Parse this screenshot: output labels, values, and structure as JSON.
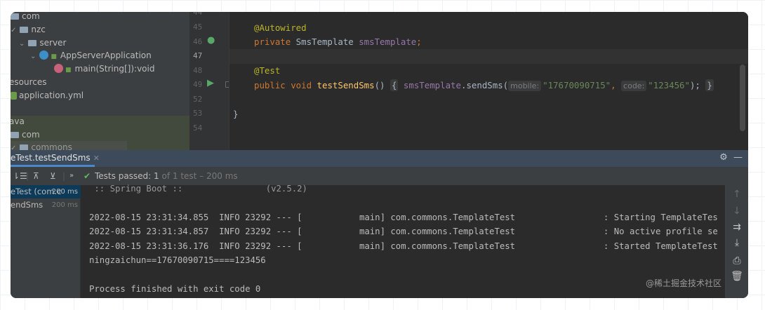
{
  "project_tree": [
    {
      "label": "com",
      "icon": "folder-icon"
    },
    {
      "label": "nzc",
      "icon": "package-icon"
    },
    {
      "label": "server",
      "icon": "package-icon"
    },
    {
      "label": "AppServerApplication",
      "icon": "spring-boot-class-icon"
    },
    {
      "label": "main(String[]):void",
      "icon": "method-icon"
    },
    {
      "label": "esources",
      "icon": ""
    },
    {
      "label": "application.yml",
      "icon": "yaml-file-icon"
    },
    {
      "label": "ava",
      "icon": ""
    },
    {
      "label": "com",
      "icon": "package-icon"
    },
    {
      "label": "commons",
      "icon": "package-icon"
    }
  ],
  "editor": {
    "line_numbers": [
      "44",
      "45",
      "46",
      "47",
      "48",
      "49",
      "52",
      "53",
      "54"
    ],
    "current_line": "47",
    "code": {
      "annotation1": "@Autowired",
      "l46_kw": "private",
      "l46_type": " SmsTemplate ",
      "l46_field": "smsTemplate",
      "l46_end": ";",
      "annotation2": "@Test",
      "l49_kw": "public void ",
      "l49_fn": "testSendSms",
      "l49_paren": "() ",
      "l49_open": "{",
      "l49_field": "smsTemplate",
      "l49_call": ".sendSms(",
      "hint_mobile": "mobile:",
      "arg_mobile": "\"17670090715\"",
      "comma": ", ",
      "hint_code": "code:",
      "arg_code": "\"123456\"",
      "l49_close": ");",
      "l49_closebrace": "}",
      "l53": "}"
    }
  },
  "run_panel": {
    "tab_label": "eTest.testSendSms",
    "status_prefix": "Tests passed: 1",
    "status_suffix": " of 1 test – 200 ms",
    "tree": [
      {
        "label": "eTest (com.c",
        "time": "200 ms"
      },
      {
        "label": "endSms",
        "time": "200 ms"
      }
    ],
    "console": [
      " :: Spring Boot ::                (v2.5.2)",
      "",
      "2022-08-15 23:31:34.855  INFO 23292 --- [           main] com.commons.TemplateTest                 : Starting TemplateTes",
      "2022-08-15 23:31:34.857  INFO 23292 --- [           main] com.commons.TemplateTest                 : No active profile se",
      "2022-08-15 23:31:36.176  INFO 23292 --- [           main] com.commons.TemplateTest                 : Started TemplateTest",
      "ningzaichun==17670090715====123456",
      "",
      "Process finished with exit code 0"
    ]
  },
  "watermark": "@稀土掘金技术社区"
}
